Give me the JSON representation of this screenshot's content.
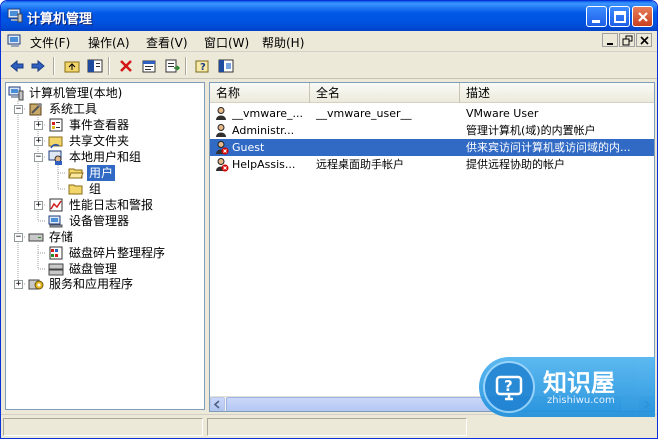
{
  "window": {
    "title": "计算机管理"
  },
  "menubar": {
    "items": [
      "文件(F)",
      "操作(A)",
      "查看(V)",
      "窗口(W)",
      "帮助(H)"
    ]
  },
  "toolbar": {
    "icons": [
      "back-arrow-icon",
      "forward-arrow-icon",
      "up-folder-icon",
      "show-hide-tree-icon",
      "delete-icon",
      "properties-icon",
      "export-list-icon",
      "help-icon",
      "console-tree-icon"
    ]
  },
  "tree": {
    "nodes": [
      {
        "label": "计算机管理(本地)",
        "icon": "computer-management-icon"
      },
      {
        "label": "系统工具",
        "icon": "system-tools-icon"
      },
      {
        "label": "事件查看器",
        "icon": "event-viewer-icon"
      },
      {
        "label": "共享文件夹",
        "icon": "shared-folder-icon"
      },
      {
        "label": "本地用户和组",
        "icon": "local-users-groups-icon"
      },
      {
        "label": "用户",
        "icon": "folder-icon",
        "selected": true
      },
      {
        "label": "组",
        "icon": "folder-icon"
      },
      {
        "label": "性能日志和警报",
        "icon": "performance-logs-icon"
      },
      {
        "label": "设备管理器",
        "icon": "device-manager-icon"
      },
      {
        "label": "存储",
        "icon": "storage-icon"
      },
      {
        "label": "磁盘碎片整理程序",
        "icon": "disk-defragmenter-icon"
      },
      {
        "label": "磁盘管理",
        "icon": "disk-management-icon"
      },
      {
        "label": "服务和应用程序",
        "icon": "services-apps-icon"
      }
    ]
  },
  "list": {
    "columns": [
      "名称",
      "全名",
      "描述"
    ],
    "rows": [
      {
        "name": "__vmware_...",
        "fullname": "__vmware_user__",
        "description": "VMware User",
        "disabled": false
      },
      {
        "name": "Administr...",
        "fullname": "",
        "description": "管理计算机(域)的内置帐户",
        "disabled": false
      },
      {
        "name": "Guest",
        "fullname": "",
        "description": "供来宾访问计算机或访问域的内...",
        "disabled": true,
        "selected": true
      },
      {
        "name": "HelpAssis...",
        "fullname": "远程桌面助手帐户",
        "description": "提供远程协助的帐户",
        "disabled": true
      }
    ]
  },
  "watermark": {
    "title": "知识屋",
    "url": "zhishiwu.com"
  },
  "colors": {
    "title_bar": "#0053e0",
    "selection": "#316ac5",
    "disabled_user_mark": "#d40000"
  }
}
